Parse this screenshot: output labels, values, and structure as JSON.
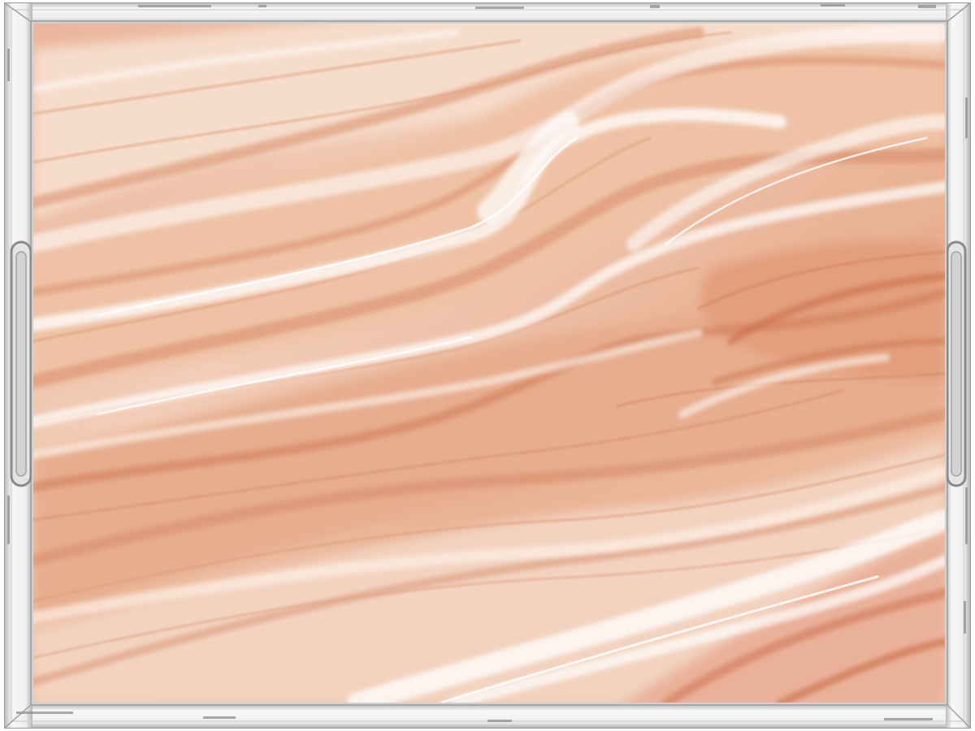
{
  "image": {
    "subject": "clear-acrylic-serving-tray",
    "surface_pattern": "flowing-marble-swirl",
    "colors": {
      "background": "#ffffff",
      "frame_edge": "#9a9a9a",
      "frame_fill": "#f3f3f3",
      "marble_base": "#f0c7b0",
      "marble_dark": "#d98a62",
      "marble_mid": "#e7ad8e",
      "marble_light": "#fbe6d9",
      "marble_highlight": "#ffffff"
    }
  }
}
